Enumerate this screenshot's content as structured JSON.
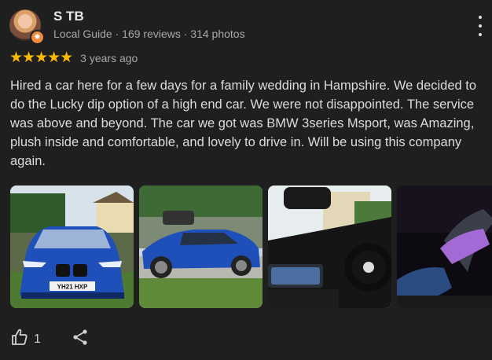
{
  "reviewer": {
    "name": "S TB",
    "meta": "Local Guide · 169 reviews · 314 photos",
    "badge_icon": "local-guide-star"
  },
  "review": {
    "stars": "★★★★★",
    "rating": 5,
    "time": "3 years ago",
    "text": "Hired a car here for a few days for a family wedding in Hampshire. We decided to do the Lucky dip option of a high end car. We were not disappointed. The service was above and beyond. The car we got was BMW 3series Msport, was Amazing, plush inside and comfortable, and lovely to drive in. Will be using this company again."
  },
  "photos": [
    {
      "name": "blue-bmw-front",
      "plate": "YH21 HXP"
    },
    {
      "name": "blue-bmw-side"
    },
    {
      "name": "bmw-interior-steering"
    },
    {
      "name": "passenger-footwell"
    }
  ],
  "actions": {
    "like_count": "1",
    "like_icon": "thumbs-up",
    "share_icon": "share"
  },
  "colors": {
    "background": "#1f1f1f",
    "star": "#fbbc04",
    "car_blue": "#1f4fb8"
  }
}
